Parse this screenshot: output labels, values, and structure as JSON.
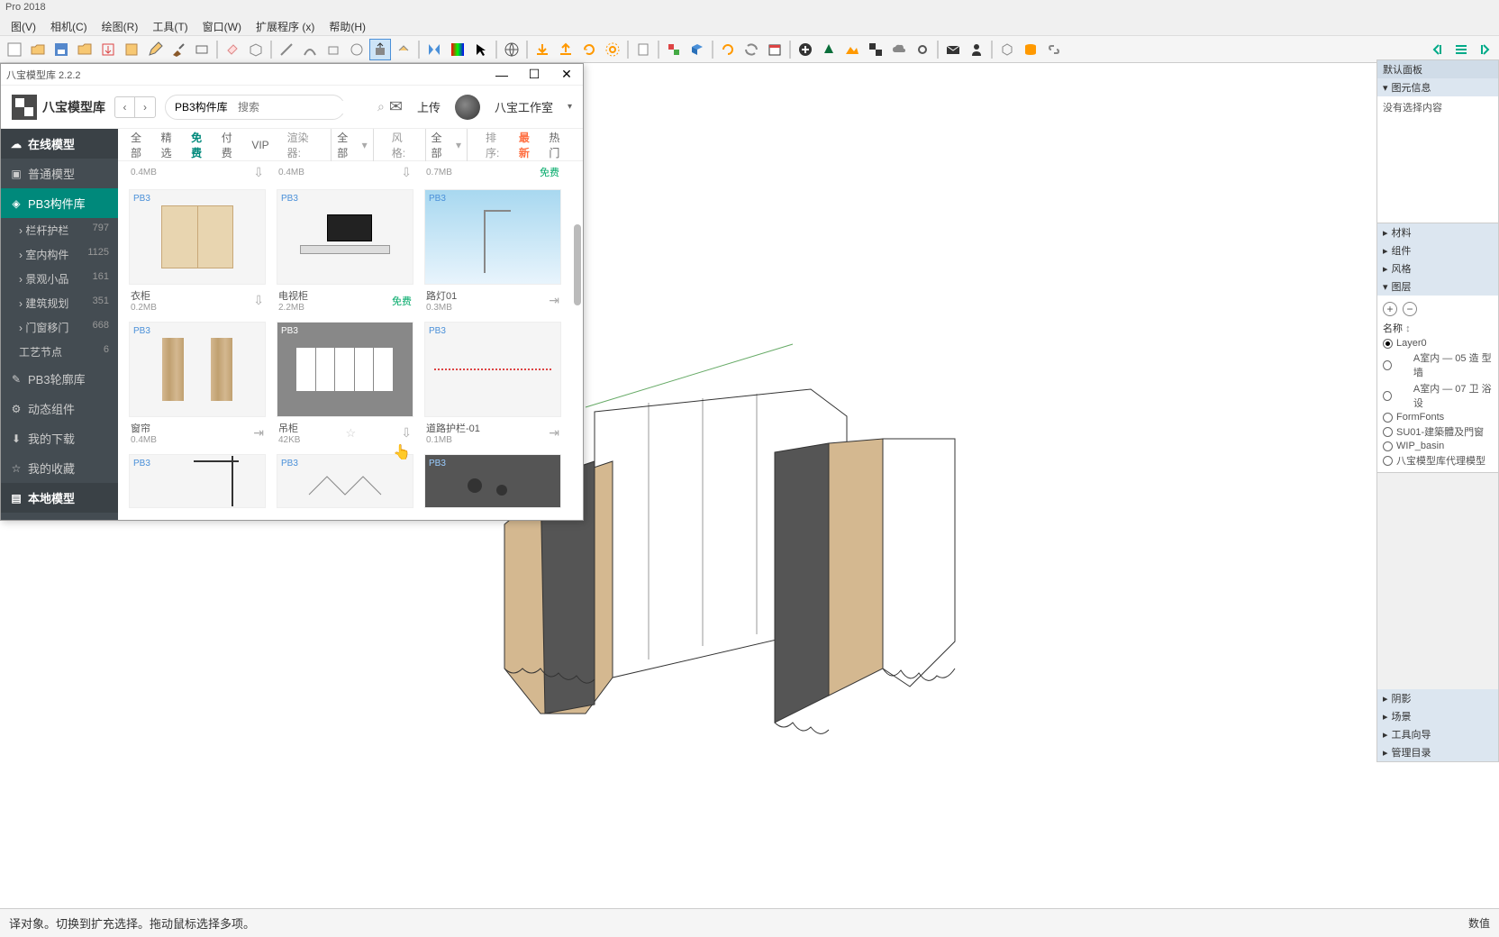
{
  "app": {
    "title": "Pro 2018"
  },
  "menu": [
    "图(V)",
    "相机(C)",
    "绘图(R)",
    "工具(T)",
    "窗口(W)",
    "扩展程序 (x)",
    "帮助(H)"
  ],
  "panel": {
    "title": "八宝模型库 2.2.2",
    "brand": "八宝模型库",
    "search_value": "PB3构件库",
    "search_placeholder": "搜索",
    "upload": "上传",
    "user": "八宝工作室"
  },
  "sidebar": {
    "header1": "在线模型",
    "item_normal": "普通模型",
    "item_active": "PB3构件库",
    "subs": [
      {
        "label": "栏杆护栏",
        "count": "797"
      },
      {
        "label": "室内构件",
        "count": "1125"
      },
      {
        "label": "景观小品",
        "count": "161"
      },
      {
        "label": "建筑规划",
        "count": "351"
      },
      {
        "label": "门窗移门",
        "count": "668"
      },
      {
        "label": "工艺节点",
        "count": "6"
      }
    ],
    "item_outline": "PB3轮廓库",
    "item_dynamic": "动态组件",
    "item_download": "我的下载",
    "item_fav": "我的收藏",
    "header2": "本地模型"
  },
  "filters": {
    "tabs": [
      "全部",
      "精选",
      "免费",
      "付费",
      "VIP"
    ],
    "renderer_label": "渲染器:",
    "renderer_value": "全部",
    "style_label": "风格:",
    "style_value": "全部",
    "sort_label": "排序:",
    "sort_latest": "最新",
    "sort_hot": "热门"
  },
  "cards": {
    "toprow": [
      {
        "size": "0.4MB"
      },
      {
        "size": "0.4MB"
      },
      {
        "size": "0.7MB",
        "price": "免费"
      }
    ],
    "row1": [
      {
        "badge": "PB3",
        "name": "衣柜",
        "size": "0.2MB"
      },
      {
        "badge": "PB3",
        "name": "电视柜",
        "size": "2.2MB",
        "price": "免费"
      },
      {
        "badge": "PB3",
        "name": "路灯01",
        "size": "0.3MB"
      }
    ],
    "row2": [
      {
        "badge": "PB3",
        "name": "窗帘",
        "size": "0.4MB"
      },
      {
        "badge": "PB3",
        "name": "吊柜",
        "size": "42KB"
      },
      {
        "badge": "PB3",
        "name": "道路护栏-01",
        "size": "0.1MB"
      }
    ],
    "row3": [
      {
        "badge": "PB3"
      },
      {
        "badge": "PB3"
      },
      {
        "badge": "PB3"
      }
    ]
  },
  "right": {
    "default_panel": "默认面板",
    "entity_info": "图元信息",
    "no_selection": "没有选择内容",
    "materials": "材料",
    "components": "组件",
    "styles": "风格",
    "layers": "图层",
    "name_label": "名称",
    "layer_list": [
      {
        "label": "Layer0",
        "checked": true
      },
      {
        "label": "A室内 — 05 造 型 墙",
        "checked": false
      },
      {
        "label": "A室内 — 07 卫 浴 设",
        "checked": false
      },
      {
        "label": "FormFonts",
        "checked": false
      },
      {
        "label": "SU01-建築體及門窗",
        "checked": false
      },
      {
        "label": "WIP_basin",
        "checked": false
      },
      {
        "label": "八宝模型库代理模型",
        "checked": false
      }
    ],
    "shadow": "阴影",
    "scene": "场景",
    "tool_guide": "工具向导",
    "manage_catalog": "管理目录"
  },
  "status": {
    "text": "译对象。切换到扩充选择。拖动鼠标选择多项。",
    "value_label": "数值"
  }
}
